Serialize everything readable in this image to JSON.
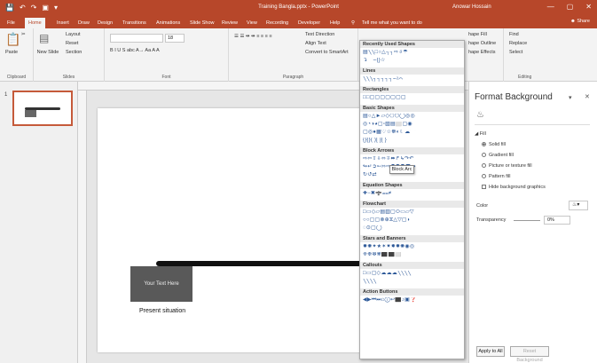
{
  "titlebar": {
    "qat": [
      "💾",
      "↶",
      "↷",
      "▣",
      "▾"
    ],
    "title": "Training Bangla.pptx - PowerPoint",
    "user": "Anowar Hossain",
    "win": [
      "—",
      "▢",
      "✕"
    ]
  },
  "tabs": [
    "File",
    "Home",
    "Insert",
    "Draw",
    "Design",
    "Transitions",
    "Animations",
    "Slide Show",
    "Review",
    "View",
    "Recording",
    "Developer",
    "Help"
  ],
  "tellme": "Tell me what you want to do",
  "share": "Share",
  "ribbon": {
    "paste": "Paste",
    "cut_icon": "✂",
    "clipboard": "Clipboard",
    "new_slide": "New Slide",
    "layout": "Layout",
    "reset": "Reset",
    "section": "Section",
    "slides": "Slides",
    "font_size": "18",
    "font_tools": "B  I  U  S  abc  A→  Aa  A  A",
    "font": "Font",
    "para_tools": "☰  ☰  ⇹  ⇹  ≡  ≡  ≡  ≡",
    "text_direction": "Text Direction",
    "align_text": "Align Text",
    "smartart": "Convert to SmartArt",
    "paragraph": "Paragraph",
    "shape_fill": "hape Fill",
    "shape_outline": "hape Outline",
    "shape_effects": "hape Effects",
    "find": "Find",
    "replace": "Replace",
    "select": "Select",
    "editing": "Editing"
  },
  "slide_number": "1",
  "slide": {
    "box_text": "Your Text Here",
    "caption": "Present situation"
  },
  "shapes": {
    "categories": [
      {
        "name": "Recently Used Shapes",
        "rows": [
          "▤╲╲□○△┐┐⇨⇩☂",
          "↴⌒⌢{}☆"
        ]
      },
      {
        "name": "Lines",
        "rows": [
          "╲╲╲┐┐┐┐┐⌢≀⌒"
        ]
      },
      {
        "name": "Rectangles",
        "rows": [
          "□□▢▢▢▢▢▢▢"
        ]
      },
      {
        "name": "Basic Shapes",
        "rows": [
          "▤○△►▱◇⬠⬡◯◎◎",
          "◎◔◑◕▢▫▧▤⬜▢◉",
          "▢◎●▦♡☆☸◐☾☁⌒",
          "{}{}(  )[ ]{ }"
        ]
      },
      {
        "name": "Block Arrows",
        "rows": [
          "⇨⇦⇧⇩⬄⇳⬌↱↳↷↶",
          "↬↵➲➳⇰⇨⬟⬟⬣⬤⇴",
          "↻↺⇄"
        ]
      },
      {
        "name": "Equation Shapes",
        "rows": [
          "✚−✖➗⩵≠"
        ]
      },
      {
        "name": "Flowchart",
        "rows": [
          "□▭◇▱▤▥▢⬭▭▱▽",
          "○○▢▢⊗⊕⧖△▽▢◗",
          "◌⊙▢◯"
        ]
      },
      {
        "name": "Stars and Banners",
        "rows": [
          "✹✺✦★✶✷✸✹✺◉◎",
          "❈❉❇❋⬛⬛⬜"
        ]
      },
      {
        "name": "Callouts",
        "rows": [
          "□▭▢◇☁☁☁╲╲╲╲",
          "╲╲╲╲"
        ]
      },
      {
        "name": "Action Buttons",
        "rows": [
          "◀▶⏮⏭⌂ⓘ↩⬛♪▣❓"
        ]
      }
    ],
    "tooltip": "Block Arc"
  },
  "format": {
    "title": "Format Background",
    "fill_header": "Fill",
    "options": [
      "Solid fill",
      "Gradient fill",
      "Picture or texture fill",
      "Pattern fill"
    ],
    "hide_bg": "Hide background graphics",
    "color_label": "Color",
    "transparency_label": "Transparency",
    "transparency_value": "0%",
    "apply_all": "Apply to All",
    "reset_bg": "Reset Background"
  },
  "colors": {
    "accent": "#b7472a",
    "ribbon": "#f3f3f3",
    "box": "#595959"
  }
}
